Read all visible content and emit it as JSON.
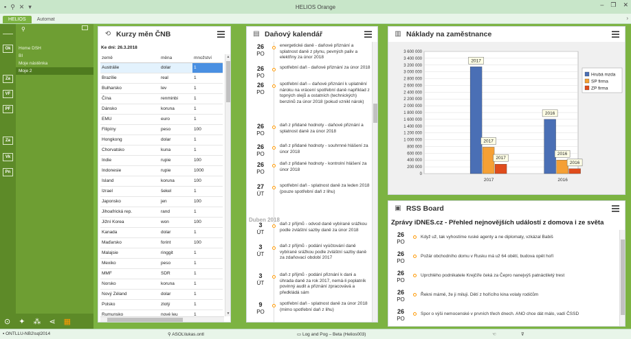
{
  "window": {
    "title": "HELIOS Orange",
    "controls": [
      "–",
      "❐",
      "✕"
    ]
  },
  "tabs": [
    {
      "label": "HELIOS",
      "active": true
    },
    {
      "label": "Automat",
      "active": false
    }
  ],
  "sidebar": {
    "rail_buttons": [
      "Ok",
      "Za",
      "VF",
      "PF",
      "Za",
      "Vk",
      "Pn"
    ],
    "nav_items": [
      {
        "label": "Home DSH",
        "selected": false
      },
      {
        "label": "BI",
        "selected": false
      },
      {
        "label": "Moje nástěnka",
        "selected": false
      },
      {
        "label": "Moje 2",
        "selected": true
      }
    ]
  },
  "kurzy": {
    "title": "Kurzy měn ČNB",
    "date_label": "Ke dni: 26.3.2018",
    "columns": [
      "země",
      "měna",
      "množství"
    ],
    "rows": [
      [
        "Austrálie",
        "dolar",
        "1"
      ],
      [
        "Brazílie",
        "real",
        "1"
      ],
      [
        "Bulharsko",
        "lev",
        "1"
      ],
      [
        "Čína",
        "renminbi",
        "1"
      ],
      [
        "Dánsko",
        "koruna",
        "1"
      ],
      [
        "EMU",
        "euro",
        "1"
      ],
      [
        "Filipíny",
        "peso",
        "100"
      ],
      [
        "Hongkong",
        "dolar",
        "1"
      ],
      [
        "Chorvatsko",
        "kuna",
        "1"
      ],
      [
        "Indie",
        "rupie",
        "100"
      ],
      [
        "Indonesie",
        "rupie",
        "1000"
      ],
      [
        "Island",
        "koruna",
        "100"
      ],
      [
        "Izrael",
        "šekel",
        "1"
      ],
      [
        "Japonsko",
        "jen",
        "100"
      ],
      [
        "Jihoafrická rep.",
        "rand",
        "1"
      ],
      [
        "Jižní Korea",
        "won",
        "100"
      ],
      [
        "Kanada",
        "dolar",
        "1"
      ],
      [
        "Maďarsko",
        "forint",
        "100"
      ],
      [
        "Malajsie",
        "ringgit",
        "1"
      ],
      [
        "Mexiko",
        "peso",
        "1"
      ],
      [
        "MMF",
        "SDR",
        "1"
      ],
      [
        "Norsko",
        "koruna",
        "1"
      ],
      [
        "Nový Zéland",
        "dolar",
        "1"
      ],
      [
        "Polsko",
        "zlotý",
        "1"
      ],
      [
        "Rumunsko",
        "nové leu",
        "1"
      ]
    ]
  },
  "calendar": {
    "title": "Daňový kalendář",
    "month_label": "Duben 2018",
    "items": [
      {
        "day": "26",
        "wd": "PO",
        "text": "energetické daně - daňové přiznání a splatnost daně z plynu, pevných paliv a elektřiny za únor 2018"
      },
      {
        "day": "26",
        "wd": "PO",
        "text": "spotřební daň - daňové přiznání za únor 2018"
      },
      {
        "day": "26",
        "wd": "PO",
        "text": "spotřební daň – daňové přiznání k uplatnění nároku na vrácení spotřební daně například z topných olejů a ostatních (technických) benzinů za únor 2018 (pokud vznikl nárok)"
      },
      {
        "day": "26",
        "wd": "PO",
        "text": "daň z přidané hodnoty - daňové přiznání a splatnost daně za únor 2018"
      },
      {
        "day": "26",
        "wd": "PO",
        "text": "daň z přidané hodnoty - souhrnné hlášení za únor 2018"
      },
      {
        "day": "26",
        "wd": "PO",
        "text": "daň z přidané hodnoty - kontrolní hlášení za únor 2018"
      },
      {
        "day": "27",
        "wd": "ÚT",
        "text": "spotřební daň - splatnost daně za leden 2018 (pouze spotřební daň z lihu)"
      },
      {
        "day": "3",
        "wd": "ÚT",
        "text": "daň z příjmů - odvod daně vybírané srážkou podle zvláštní sazby daně za únor 2018"
      },
      {
        "day": "3",
        "wd": "ÚT",
        "text": "daň z příjmů - podání vyúčtování daně vybírané srážkou podle zvláštní sazby daně za zdaňovací období 2017"
      },
      {
        "day": "3",
        "wd": "ÚT",
        "text": "daň z příjmů - podání přiznání k dani a úhrada daně za rok 2017, nemá-li poplatník povinný audit a přiznání zpracovává a předkládá sám"
      },
      {
        "day": "9",
        "wd": "PO",
        "text": "spotřební daň - splatnost daně za únor 2018 (mimo spotřební daň z lihu)"
      }
    ]
  },
  "naklady": {
    "title": "Náklady na zaměstnance"
  },
  "chart_data": {
    "type": "bar",
    "categories": [
      "2017",
      "2016"
    ],
    "series": [
      {
        "name": "Hrubá mzda",
        "color": "#4a6fb5",
        "values": [
          3150000,
          1600000
        ]
      },
      {
        "name": "SP firma",
        "color": "#f5a035",
        "values": [
          780000,
          400000
        ]
      },
      {
        "name": "ZP firma",
        "color": "#e04c1c",
        "values": [
          280000,
          145000
        ]
      }
    ],
    "data_labels": [
      [
        "2017",
        "2016"
      ],
      [
        "2017",
        "2016"
      ],
      [
        "2017",
        "2016"
      ]
    ],
    "yticks": [
      "0",
      "200 000",
      "400 000",
      "600 000",
      "800 000",
      "1 000 000",
      "1 200 000",
      "1 400 000",
      "1 600 000",
      "1 800 000",
      "2 000 000",
      "2 200 000",
      "2 400 000",
      "2 600 000",
      "2 800 000",
      "3 000 000",
      "3 200 000",
      "3 400 000",
      "3 600 000"
    ],
    "ylim": [
      0,
      3600000
    ],
    "grid": true,
    "legend_position": "right"
  },
  "rss": {
    "title": "RSS Board",
    "feed_title": "Zprávy iDNES.cz - Přehled nejnovějších událostí z domova i ze světa",
    "items": [
      {
        "day": "26",
        "wd": "PO",
        "text": "Když už, tak vyhostíme ruské agenty a ne diplomaty, vzkázal Babiš"
      },
      {
        "day": "26",
        "wd": "PO",
        "text": "Požár obchodního domu v Rusku má už 64 obětí, budova opět hoří"
      },
      {
        "day": "26",
        "wd": "PO",
        "text": "Uprchlého podnikatele Krejčíře čeká za Čepro nanejvýš patnáctiletý trest"
      },
      {
        "day": "26",
        "wd": "PO",
        "text": "Řekni mámě, že ji miluji. Dětí z hořícího kina volaly rodičům"
      },
      {
        "day": "26",
        "wd": "PO",
        "text": "Spor o výši nemocenské v prvních třech dnech. ANO chce dát málo, vadí ČSSD"
      }
    ]
  },
  "statusbar": {
    "server": "ONTLLU-NB2\\sql2014",
    "user": "ASOL\\lukas.ontl",
    "db": "Log and Pog – Beta (Helios003)"
  }
}
